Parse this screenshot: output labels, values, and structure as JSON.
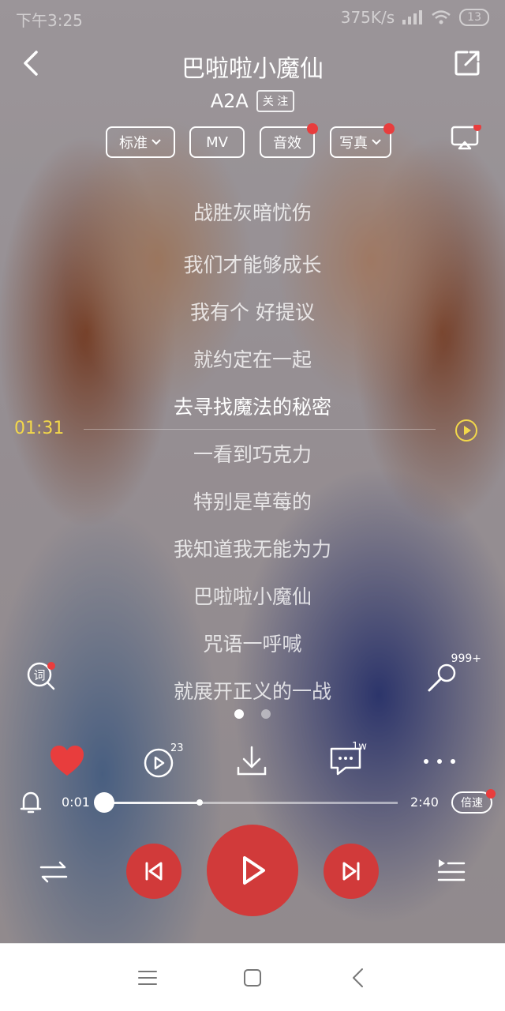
{
  "status_bar": {
    "time": "下午3:25",
    "network_speed": "375K/s",
    "battery": "13"
  },
  "header": {
    "title": "巴啦啦小魔仙",
    "artist": "A2A",
    "follow_label": "关 注"
  },
  "tags": [
    {
      "label": "标准",
      "dropdown": true,
      "badge": false
    },
    {
      "label": "MV",
      "dropdown": false,
      "badge": false
    },
    {
      "label": "音效",
      "dropdown": false,
      "badge": true
    },
    {
      "label": "写真",
      "dropdown": true,
      "badge": true
    }
  ],
  "lyrics": [
    "战胜灰暗忧伤",
    "我们才能够成长",
    "我有个 好提议",
    "就约定在一起",
    "去寻找魔法的秘密",
    "一看到巧克力",
    "特别是草莓的",
    "我知道我无能为力",
    "巴啦啦小魔仙",
    "咒语一呼喊",
    "就展开正义的一战"
  ],
  "current_lyric_index": 4,
  "timeline": {
    "time": "01:31"
  },
  "comments_count": "999+",
  "share_count": "23",
  "messages_count": "1w",
  "playback": {
    "current_time": "0:01",
    "total_time": "2:40",
    "speed_label": "倍速",
    "progress": 0.006,
    "buffered": 0.33
  },
  "colors": {
    "accent": "#d13a3a",
    "lyric_timeline": "#f3d84a"
  }
}
